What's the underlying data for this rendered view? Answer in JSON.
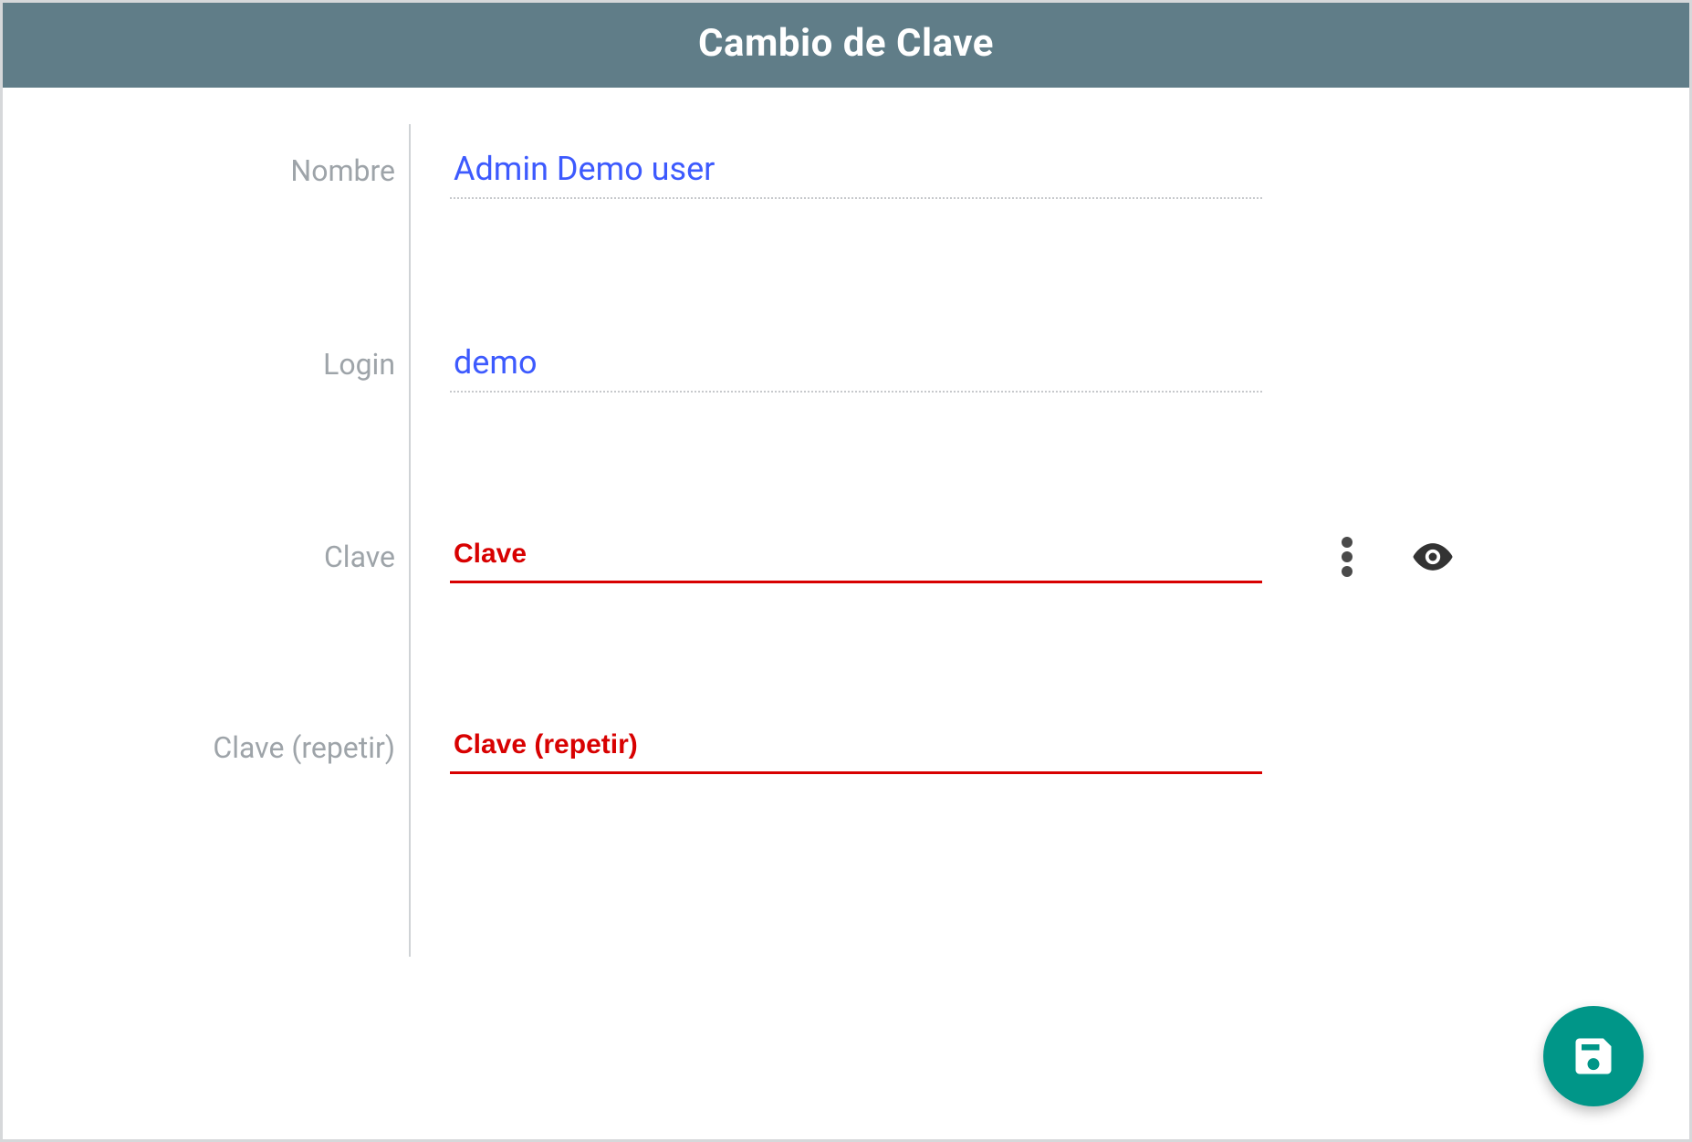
{
  "header": {
    "title": "Cambio de Clave"
  },
  "form": {
    "name_label": "Nombre",
    "name_value": "Admin Demo user",
    "login_label": "Login",
    "login_value": "demo",
    "password_label": "Clave",
    "password_placeholder": "Clave",
    "password_repeat_label": "Clave (repetir)",
    "password_repeat_placeholder": "Clave (repetir)"
  },
  "icons": {
    "more": "more-vert-icon",
    "visibility": "eye-icon",
    "save": "save-icon"
  },
  "colors": {
    "accent": "#009688",
    "error": "#d80101",
    "link": "#3d5afe",
    "header_bg": "#607d88"
  }
}
